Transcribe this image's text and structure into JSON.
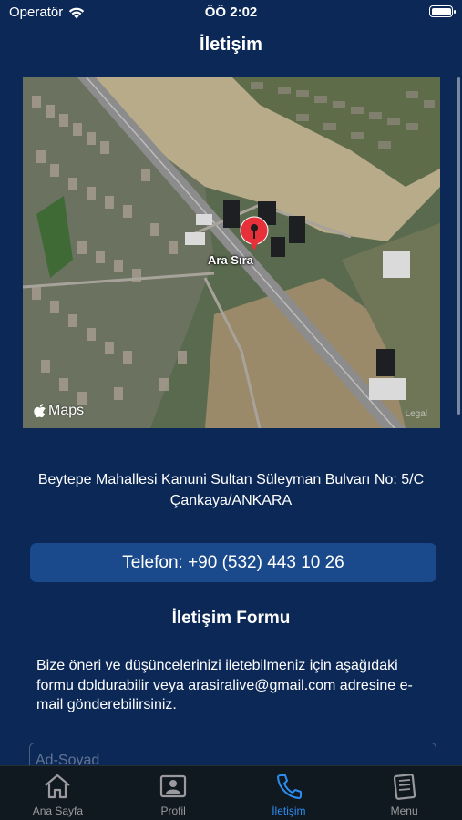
{
  "status_bar": {
    "carrier": "Operatör",
    "time": "ÖÖ 2:02",
    "wifi_icon": "wifi-icon",
    "battery_icon": "battery-icon"
  },
  "nav": {
    "title": "İletişim"
  },
  "map": {
    "pin_label": "Ara Sıra",
    "logo_text": "Maps",
    "legal_text": "Legal",
    "pin_color": "#e8303a"
  },
  "contact": {
    "address": "Beytepe Mahallesi Kanuni Sultan Süleyman Bulvarı No: 5/C Çankaya/ANKARA",
    "phone_label": "Telefon: +90 (532) 443 10 26"
  },
  "form": {
    "title": "İletişim Formu",
    "description": "Bize öneri ve düşüncelerinizi iletebilmeniz için aşağıdaki formu doldurabilir veya arasiralive@gmail.com adresine e-mail gönderebilirsiniz.",
    "name_placeholder": "Ad-Soyad"
  },
  "tabs": [
    {
      "label": "Ana Sayfa",
      "icon": "home-icon",
      "active": false
    },
    {
      "label": "Profil",
      "icon": "profile-icon",
      "active": false
    },
    {
      "label": "İletişim",
      "icon": "phone-icon",
      "active": true
    },
    {
      "label": "Menu",
      "icon": "menu-book-icon",
      "active": false
    }
  ],
  "colors": {
    "background": "#0b2857",
    "button": "#1a4a8c",
    "tab_active": "#2d8cf0",
    "tab_inactive": "#9a9a9e"
  }
}
